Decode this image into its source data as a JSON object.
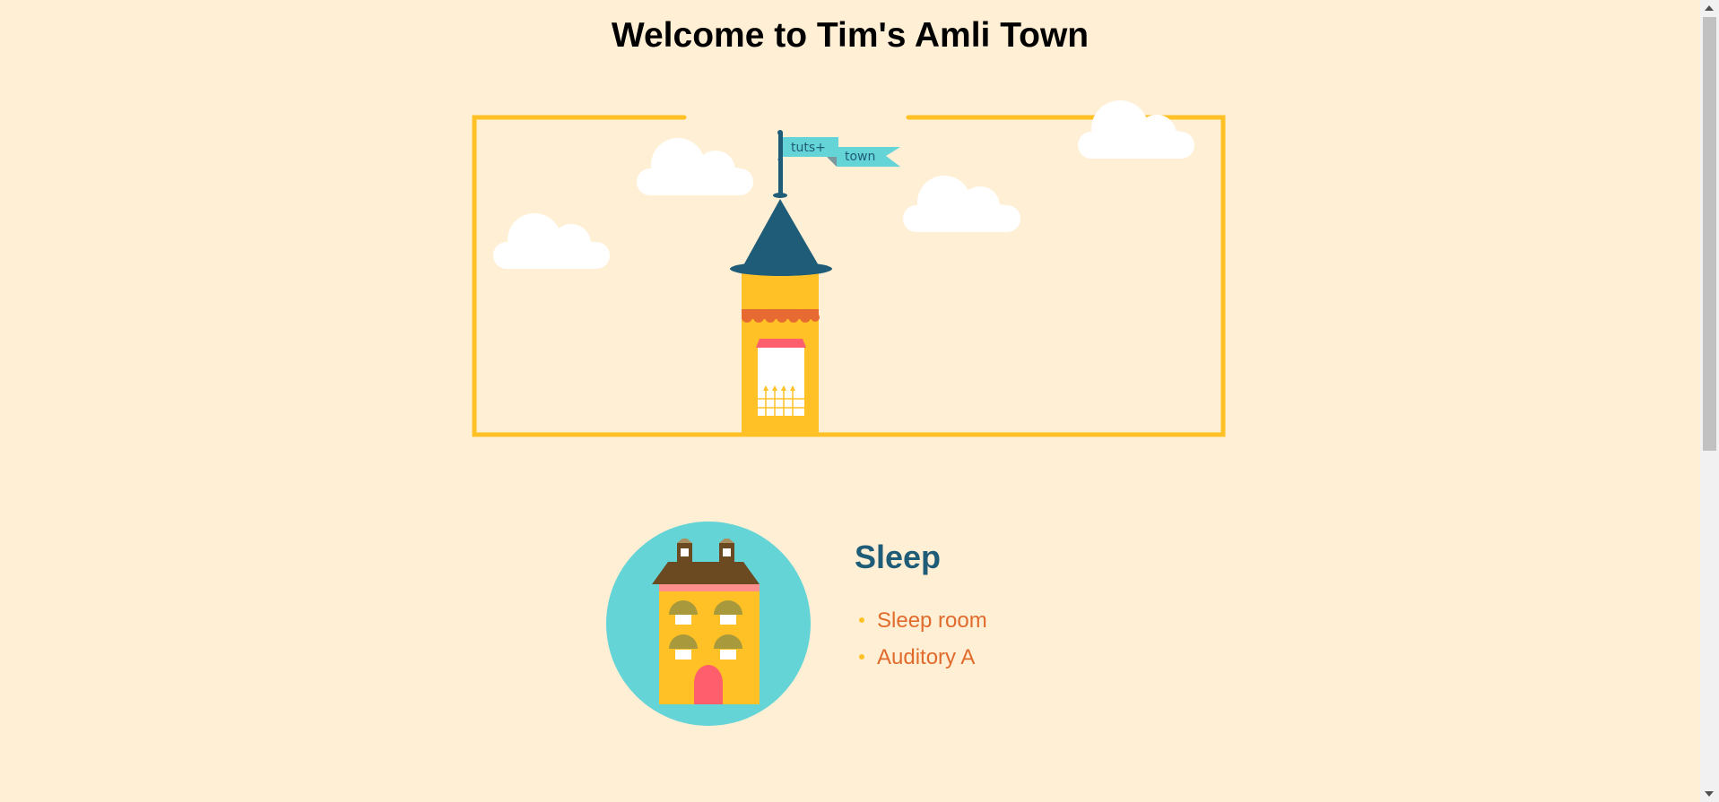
{
  "page": {
    "title": "Welcome to Tim's Amli Town",
    "background": "#FFEFD5"
  },
  "hero": {
    "flag_top_text": "tuts+",
    "flag_bottom_text": "town",
    "frame_color": "#FFC125",
    "roof_color": "#1F5C78",
    "tower_color": "#FFC125",
    "awning_color": "#E86A33",
    "flag_color": "#64D4D6"
  },
  "section": {
    "title": "Sleep",
    "items": [
      "Sleep room",
      "Auditory A"
    ],
    "circle_color": "#64D4D6",
    "title_color": "#1F5C78",
    "item_color": "#E06B2C"
  }
}
